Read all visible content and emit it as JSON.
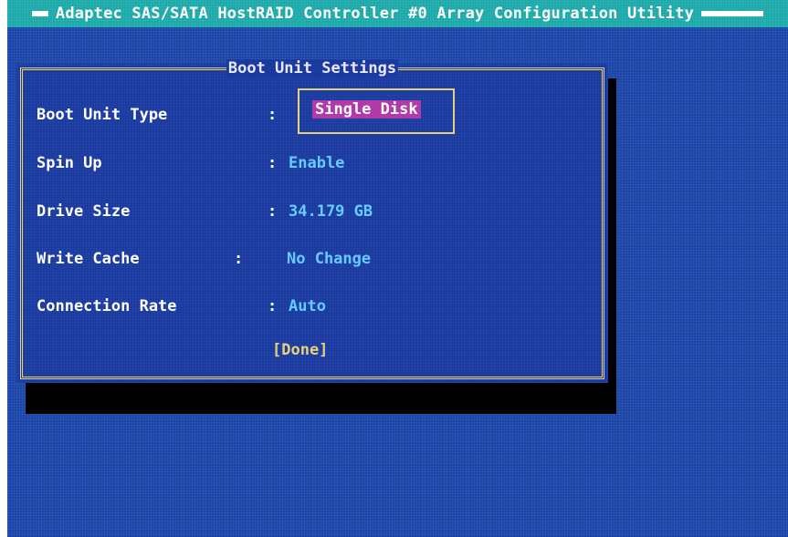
{
  "titlebar": {
    "title": "Adaptec SAS/SATA HostRAID Controller #0 Array Configuration Utility"
  },
  "dialog": {
    "title": "Boot Unit Settings",
    "rows": [
      {
        "label": "Boot Unit Type",
        "colon": ":",
        "value": "Single Disk"
      },
      {
        "label": "Spin Up",
        "colon": ":",
        "value": "Enable"
      },
      {
        "label": "Drive Size",
        "colon": ":",
        "value": "34.179 GB"
      },
      {
        "label": "Write Cache",
        "colon": ":",
        "value": "No Change"
      },
      {
        "label": "Connection Rate",
        "colon": ":",
        "value": "Auto"
      }
    ],
    "done_label": "[Done]"
  },
  "colors": {
    "background": "#1a44a8",
    "titlebar": "#1aa8a8",
    "frame": "#e6d27a",
    "value_text": "#66ccff",
    "selection": "#b03aa8"
  }
}
